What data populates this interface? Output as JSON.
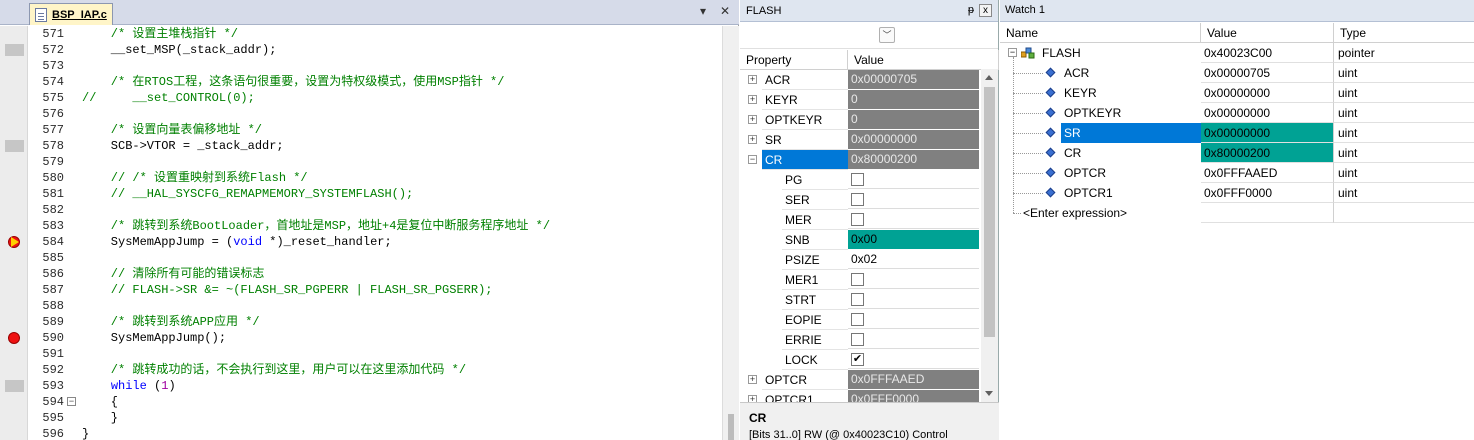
{
  "editor": {
    "tab_name": "BSP_IAP.c",
    "lines": [
      {
        "n": "571",
        "parts": [
          {
            "t": "    /* 设置主堆栈指针 */",
            "c": "comment"
          }
        ],
        "marker": "none",
        "fold": ""
      },
      {
        "n": "572",
        "parts": [
          {
            "t": "    __set_MSP(_stack_addr);",
            "c": "code"
          }
        ],
        "marker": "grey",
        "fold": ""
      },
      {
        "n": "573",
        "parts": [
          {
            "t": "",
            "c": "code"
          }
        ],
        "marker": "none",
        "fold": ""
      },
      {
        "n": "574",
        "parts": [
          {
            "t": "    /* 在RTOS工程，这条语句很重要，设置为特权级模式，使用MSP指针 */",
            "c": "comment"
          }
        ],
        "marker": "none",
        "fold": ""
      },
      {
        "n": "575",
        "parts": [
          {
            "t": "//     __set_CONTROL(0);",
            "c": "comment"
          }
        ],
        "marker": "none",
        "fold": ""
      },
      {
        "n": "576",
        "parts": [
          {
            "t": "",
            "c": "code"
          }
        ],
        "marker": "none",
        "fold": ""
      },
      {
        "n": "577",
        "parts": [
          {
            "t": "    /* 设置向量表偏移地址 */",
            "c": "comment"
          }
        ],
        "marker": "none",
        "fold": ""
      },
      {
        "n": "578",
        "parts": [
          {
            "t": "    SCB->VTOR = _stack_addr;",
            "c": "code"
          }
        ],
        "marker": "grey",
        "fold": ""
      },
      {
        "n": "579",
        "parts": [
          {
            "t": "",
            "c": "code"
          }
        ],
        "marker": "none",
        "fold": ""
      },
      {
        "n": "580",
        "parts": [
          {
            "t": "    // /* 设置重映射到系统Flash */",
            "c": "comment"
          }
        ],
        "marker": "none",
        "fold": ""
      },
      {
        "n": "581",
        "parts": [
          {
            "t": "    // __HAL_SYSCFG_REMAPMEMORY_SYSTEMFLASH();",
            "c": "comment"
          }
        ],
        "marker": "none",
        "fold": ""
      },
      {
        "n": "582",
        "parts": [
          {
            "t": "",
            "c": "code"
          }
        ],
        "marker": "none",
        "fold": ""
      },
      {
        "n": "583",
        "parts": [
          {
            "t": "    /* 跳转到系统BootLoader，首地址是MSP，地址+4是复位中断服务程序地址 */",
            "c": "comment"
          }
        ],
        "marker": "none",
        "fold": ""
      },
      {
        "n": "584",
        "parts": [
          {
            "t": "    SysMemAppJump = (",
            "c": "code"
          },
          {
            "t": "void",
            "c": "kw"
          },
          {
            "t": " *)_reset_handler;",
            "c": "code"
          }
        ],
        "marker": "bp-arrow",
        "fold": ""
      },
      {
        "n": "585",
        "parts": [
          {
            "t": "",
            "c": "code"
          }
        ],
        "marker": "none",
        "fold": ""
      },
      {
        "n": "586",
        "parts": [
          {
            "t": "    // 清除所有可能的错误标志",
            "c": "comment"
          }
        ],
        "marker": "none",
        "fold": ""
      },
      {
        "n": "587",
        "parts": [
          {
            "t": "    // FLASH->SR &= ~(FLASH_SR_PGPERR | FLASH_SR_PGSERR);",
            "c": "comment"
          }
        ],
        "marker": "none",
        "fold": ""
      },
      {
        "n": "588",
        "parts": [
          {
            "t": "",
            "c": "code"
          }
        ],
        "marker": "none",
        "fold": ""
      },
      {
        "n": "589",
        "parts": [
          {
            "t": "    /* 跳转到系统APP应用 */",
            "c": "comment"
          }
        ],
        "marker": "none",
        "fold": ""
      },
      {
        "n": "590",
        "parts": [
          {
            "t": "    SysMemAppJump();",
            "c": "code"
          }
        ],
        "marker": "bp",
        "fold": ""
      },
      {
        "n": "591",
        "parts": [
          {
            "t": "",
            "c": "code"
          }
        ],
        "marker": "none",
        "fold": ""
      },
      {
        "n": "592",
        "parts": [
          {
            "t": "    /* 跳转成功的话，不会执行到这里，用户可以在这里添加代码 */",
            "c": "comment"
          }
        ],
        "marker": "none",
        "fold": ""
      },
      {
        "n": "593",
        "parts": [
          {
            "t": "    ",
            "c": "code"
          },
          {
            "t": "while",
            "c": "kw"
          },
          {
            "t": " (",
            "c": "code"
          },
          {
            "t": "1",
            "c": "num"
          },
          {
            "t": ")",
            "c": "code"
          }
        ],
        "marker": "grey",
        "fold": ""
      },
      {
        "n": "594",
        "parts": [
          {
            "t": "    {",
            "c": "code"
          }
        ],
        "marker": "none",
        "fold": "−"
      },
      {
        "n": "595",
        "parts": [
          {
            "t": "    }",
            "c": "code"
          }
        ],
        "marker": "none",
        "fold": ""
      },
      {
        "n": "596",
        "parts": [
          {
            "t": "}",
            "c": "code"
          }
        ],
        "marker": "none",
        "fold": ""
      }
    ]
  },
  "flash": {
    "title": "FLASH",
    "pin": "ᵽ",
    "close": "x",
    "header_property": "Property",
    "header_value": "Value",
    "rows": [
      {
        "name": "ACR",
        "value": "0x00000705",
        "style": "grey",
        "level": 0,
        "exp": "+"
      },
      {
        "name": "KEYR",
        "value": "0",
        "style": "grey",
        "level": 0,
        "exp": "+"
      },
      {
        "name": "OPTKEYR",
        "value": "0",
        "style": "grey",
        "level": 0,
        "exp": "+"
      },
      {
        "name": "SR",
        "value": "0x00000000",
        "style": "grey",
        "level": 0,
        "exp": "+"
      },
      {
        "name": "CR",
        "value": "0x80000200",
        "style": "grey",
        "level": 0,
        "exp": "−",
        "selected": true
      },
      {
        "name": "PG",
        "value": "",
        "style": "check",
        "checked": false,
        "level": 1
      },
      {
        "name": "SER",
        "value": "",
        "style": "check",
        "checked": false,
        "level": 1
      },
      {
        "name": "MER",
        "value": "",
        "style": "check",
        "checked": false,
        "level": 1
      },
      {
        "name": "SNB",
        "value": "0x00",
        "style": "teal",
        "level": 1
      },
      {
        "name": "PSIZE",
        "value": "0x02",
        "style": "white",
        "level": 1
      },
      {
        "name": "MER1",
        "value": "",
        "style": "check",
        "checked": false,
        "level": 1
      },
      {
        "name": "STRT",
        "value": "",
        "style": "check",
        "checked": false,
        "level": 1
      },
      {
        "name": "EOPIE",
        "value": "",
        "style": "check",
        "checked": false,
        "level": 1
      },
      {
        "name": "ERRIE",
        "value": "",
        "style": "check",
        "checked": false,
        "level": 1
      },
      {
        "name": "LOCK",
        "value": "",
        "style": "check",
        "checked": true,
        "level": 1
      },
      {
        "name": "OPTCR",
        "value": "0x0FFFAAED",
        "style": "grey",
        "level": 0,
        "exp": "+"
      },
      {
        "name": "OPTCR1",
        "value": "0x0FFF0000",
        "style": "grey",
        "level": 0,
        "exp": "+"
      }
    ],
    "description": {
      "title": "CR",
      "text": "[Bits 31..0] RW (@ 0x40023C10) Control"
    }
  },
  "watch": {
    "title": "Watch 1",
    "headers": {
      "name": "Name",
      "value": "Value",
      "type": "Type"
    },
    "rows": [
      {
        "name": "FLASH",
        "value": "0x40023C00",
        "type": "pointer",
        "level": 0,
        "exp": "−",
        "icon": "struct"
      },
      {
        "name": "ACR",
        "value": "0x00000705",
        "type": "uint",
        "level": 1
      },
      {
        "name": "KEYR",
        "value": "0x00000000",
        "type": "uint",
        "level": 1
      },
      {
        "name": "OPTKEYR",
        "value": "0x00000000",
        "type": "uint",
        "level": 1
      },
      {
        "name": "SR",
        "value": "0x00000000",
        "type": "uint",
        "level": 1,
        "selected": true,
        "highlight": true
      },
      {
        "name": "CR",
        "value": "0x80000200",
        "type": "uint",
        "level": 1,
        "highlight": true
      },
      {
        "name": "OPTCR",
        "value": "0x0FFFAAED",
        "type": "uint",
        "level": 1
      },
      {
        "name": "OPTCR1",
        "value": "0x0FFF0000",
        "type": "uint",
        "level": 1
      },
      {
        "name": "<Enter expression>",
        "value": "",
        "type": "",
        "level": -1
      }
    ]
  }
}
